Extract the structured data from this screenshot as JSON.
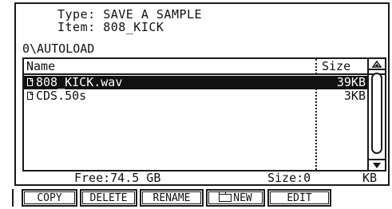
{
  "header": {
    "type_label": "Type:",
    "type_value": "SAVE A SAMPLE",
    "item_label": "Item:",
    "item_value": "808_KICK"
  },
  "path": "0\\AUTOLOAD",
  "columns": {
    "name": "Name",
    "size": "Size"
  },
  "files": [
    {
      "name": "808_KICK.wav",
      "size": "39KB",
      "selected": true,
      "icon": "file-icon"
    },
    {
      "name": "CDS.50s",
      "size": "3KB",
      "selected": false,
      "icon": "file-icon"
    }
  ],
  "status": {
    "free": "Free:74.5 GB",
    "size": "Size:0",
    "size_unit": "KB"
  },
  "buttons": {
    "copy": "COPY",
    "delete": "DELETE",
    "rename": "RENAME",
    "new": "NEW",
    "edit": "EDIT"
  },
  "icons": {
    "scroll_up": "arrow-up-icon",
    "scroll_down": "arrow-down-icon",
    "new": "folder-icon"
  }
}
